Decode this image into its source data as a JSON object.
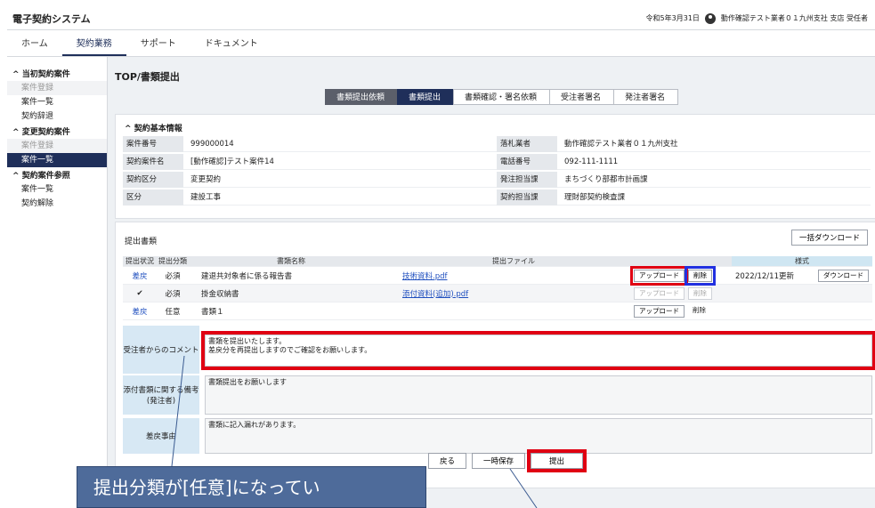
{
  "app": {
    "title": "電子契約システム"
  },
  "header": {
    "date": "令和5年3月31日",
    "user": "動作確認テスト業者０１九州支社 支店 受任者"
  },
  "menu": [
    "ホーム",
    "契約業務",
    "サポート",
    "ドキュメント"
  ],
  "sidebar": {
    "sections": [
      {
        "head": "当初契約案件",
        "items": [
          "案件登録",
          "案件一覧",
          "契約辞退"
        ]
      },
      {
        "head": "変更契約案件",
        "items": [
          "案件登録",
          "案件一覧"
        ]
      },
      {
        "head": "契約案件参照",
        "items": [
          "案件一覧",
          "契約解除"
        ]
      }
    ]
  },
  "page": {
    "title": "TOP/書類提出"
  },
  "steps": [
    "書類提出依頼",
    "書類提出",
    "書類確認・署名依頼",
    "受注者署名",
    "発注者署名"
  ],
  "info": {
    "head": "契約基本情報",
    "rows": [
      {
        "l1": "案件番号",
        "v1": "999000014",
        "l2": "落札業者",
        "v2": "動作確認テスト業者０１九州支社"
      },
      {
        "l1": "契約案件名",
        "v1": "[動作確認]テスト案件14",
        "l2": "電話番号",
        "v2": "092-111-1111"
      },
      {
        "l1": "契約区分",
        "v1": "変更契約",
        "l2": "発注担当課",
        "v2": "まちづくり部都市計画課"
      },
      {
        "l1": "区分",
        "v1": "建設工事",
        "l2": "契約担当課",
        "v2": "理財部契約検査課"
      }
    ]
  },
  "docs": {
    "title": "提出書類",
    "bulk_download": "一括ダウンロード",
    "headers": {
      "status": "提出状況",
      "class": "提出分類",
      "name": "書類名称",
      "file": "提出ファイル",
      "style": "様式"
    },
    "rows": [
      {
        "status": "差戻",
        "class": "必須",
        "name": "建退共対象者に係る報告書",
        "file": "技術資料.pdf",
        "upload": "アップロード",
        "delete": "削除",
        "style_date": "2022/12/11更新",
        "download": "ダウンロード"
      },
      {
        "status": "✔",
        "class": "必須",
        "name": "掛金収納書",
        "file": "添付資料(追加).pdf",
        "upload": "アップロード",
        "delete": "削除",
        "style_date": "",
        "download": ""
      },
      {
        "status": "差戻",
        "class": "任意",
        "name": "書類１",
        "file": "",
        "upload": "アップロード",
        "delete": "削除",
        "style_date": "",
        "download": ""
      }
    ],
    "comments": [
      {
        "label": "受注者からのコメント",
        "text": "書類を提出いたします。\n差戻分を再提出しますのでご確認をお願いします。"
      },
      {
        "label": "添付書類に関する備考\n(発注者)",
        "text": "書類提出をお願いします"
      },
      {
        "label": "差戻事由",
        "text": "書類に記入漏れがあります。"
      }
    ]
  },
  "footer": {
    "back": "戻る",
    "save": "一時保存",
    "submit": "提出"
  },
  "callout": {
    "text": "提出分類が[任意]になってい"
  },
  "colors": {
    "navy": "#1f2f5a",
    "highlight_red": "#e00012",
    "highlight_blue": "#2130e0",
    "callout": "#4e6b9a"
  }
}
